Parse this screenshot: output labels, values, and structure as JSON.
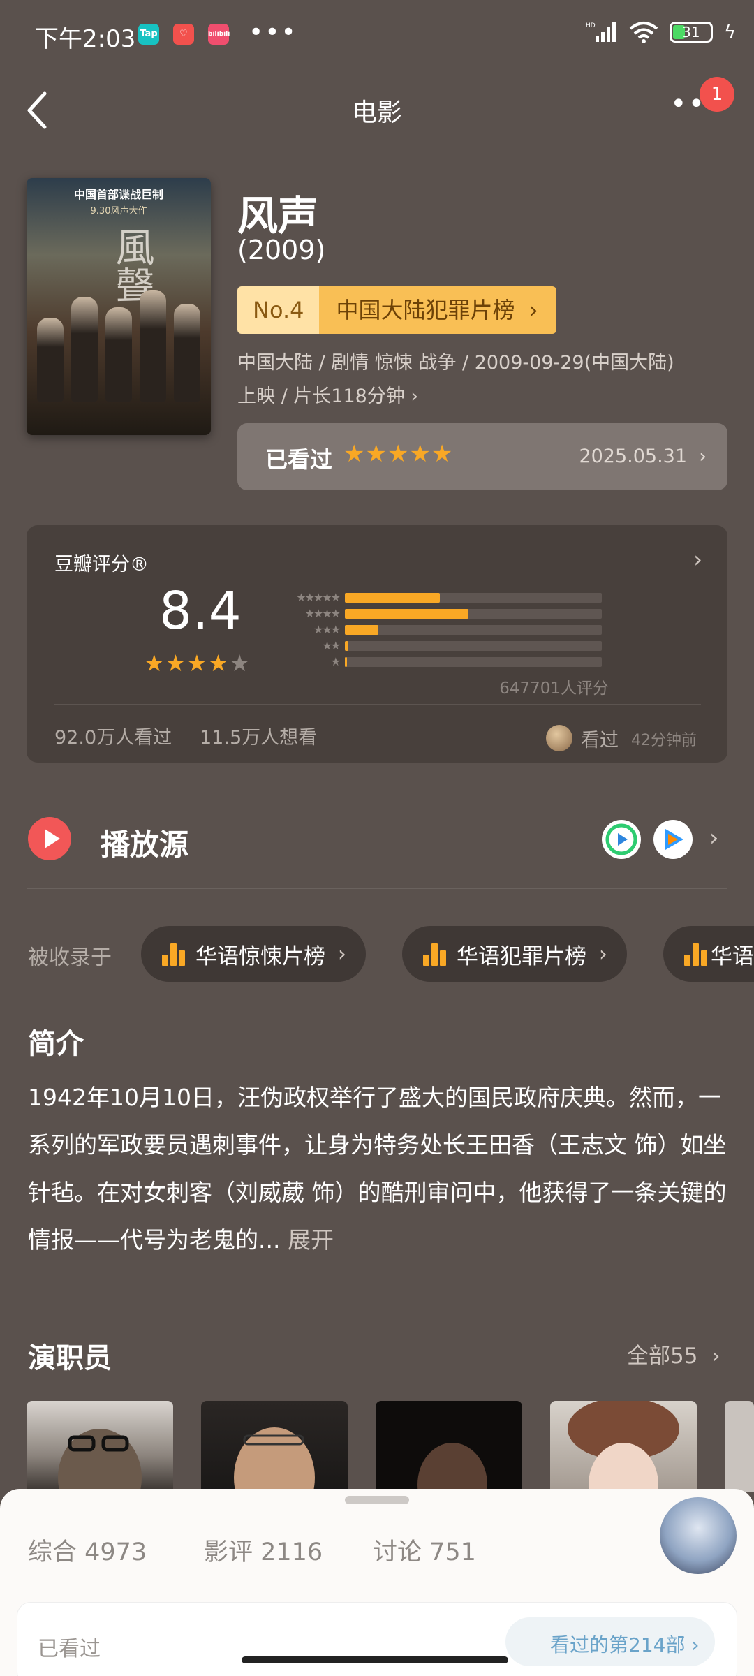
{
  "status_bar": {
    "time": "下午2:03",
    "apps": [
      "Tap",
      "",
      "bilibili"
    ],
    "battery": "31"
  },
  "nav": {
    "title": "电影",
    "notification_count": "1"
  },
  "movie": {
    "poster_text_top": "中国首部谍战巨制",
    "poster_text_date": "9.30风声大作",
    "poster_title": "風聲",
    "title": "风声",
    "year": "(2009)",
    "rank_no": "No.4",
    "rank_label": "中国大陆犯罪片榜",
    "meta_line1": "中国大陆 / 剧情 惊悚 战争 / 2009-09-29(中国大陆)",
    "meta_line2": "上映 / 片长118分钟"
  },
  "watched": {
    "label": "已看过",
    "stars": "★★★★★",
    "date": "2025.05.31"
  },
  "rating": {
    "header": "豆瓣评分®",
    "score": "8.4",
    "stars_full": "★★★★",
    "stars_empty": "★",
    "histogram": [
      {
        "stars": "★★★★★",
        "percent": 37.0
      },
      {
        "stars": "★★★★",
        "percent": 48.0
      },
      {
        "stars": "★★★",
        "percent": 13.0
      },
      {
        "stars": "★★",
        "percent": 1.3
      },
      {
        "stars": "★",
        "percent": 0.7
      }
    ],
    "count": "647701人评分",
    "seen": "92.0万人看过",
    "want": "11.5万人想看",
    "friend_action": "看过",
    "friend_time": "42分钟前"
  },
  "play_source": {
    "label": "播放源"
  },
  "collected": {
    "label": "被收录于",
    "chips": [
      "华语惊悚片榜",
      "华语犯罪片榜",
      "华语"
    ]
  },
  "intro": {
    "title": "简介",
    "text": "1942年10月10日，汪伪政权举行了盛大的国民政府庆典。然而，一系列的军政要员遇刺事件，让身为特务处长王田香（王志文 饰）如坐针毡。在对女刺客（刘威葳 饰）的酷刑审问中，他获得了一条关键的情报——代号为老鬼的...",
    "more": "展开"
  },
  "cast": {
    "title": "演职员",
    "all": "全部55"
  },
  "bottom_sheet": {
    "tabs": [
      "综合 4973",
      "影评 2116",
      "讨论 751"
    ],
    "card_left": "已看过",
    "card_right": "看过的第214部"
  },
  "colors": {
    "background": "#5a514d",
    "accent_star": "#f9a825",
    "rank_badge": "#f9bf55",
    "play_red": "#f25757"
  }
}
